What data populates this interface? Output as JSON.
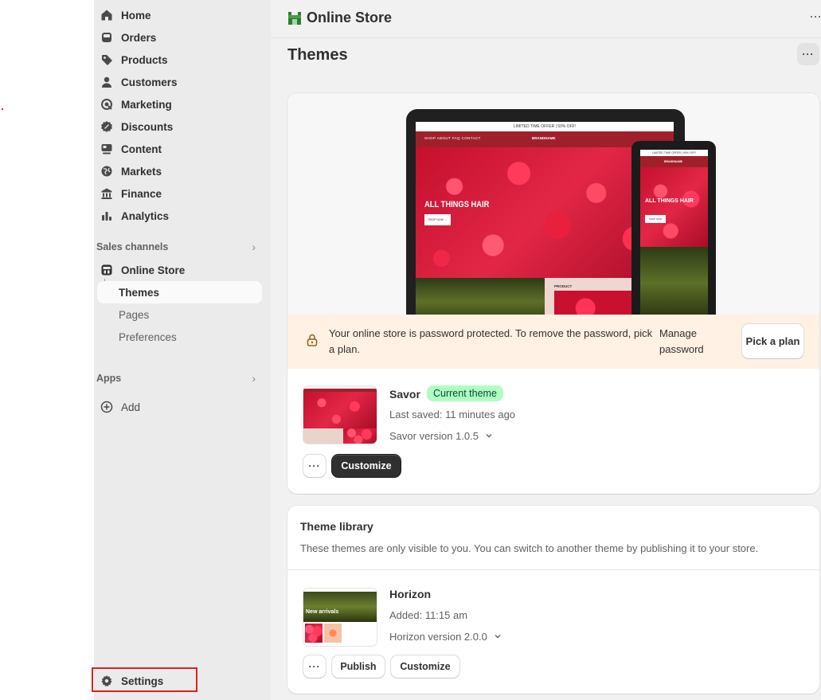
{
  "sidebar": {
    "items": [
      {
        "label": "Home",
        "icon": "home-icon"
      },
      {
        "label": "Orders",
        "icon": "inbox-icon"
      },
      {
        "label": "Products",
        "icon": "tag-icon"
      },
      {
        "label": "Customers",
        "icon": "person-icon"
      },
      {
        "label": "Marketing",
        "icon": "target-icon"
      },
      {
        "label": "Discounts",
        "icon": "discount-icon"
      },
      {
        "label": "Content",
        "icon": "content-icon"
      },
      {
        "label": "Markets",
        "icon": "globe-icon"
      },
      {
        "label": "Finance",
        "icon": "bank-icon"
      },
      {
        "label": "Analytics",
        "icon": "bar-chart-icon"
      }
    ],
    "sales_channels_label": "Sales channels",
    "online_store_label": "Online Store",
    "sub_items": [
      "Themes",
      "Pages",
      "Preferences"
    ],
    "apps_label": "Apps",
    "add_label": "Add",
    "settings_label": "Settings"
  },
  "topbar": {
    "title": "Online Store",
    "more": "···"
  },
  "page": {
    "title": "Themes",
    "more": "···"
  },
  "preview": {
    "promo": "LIMITED TIME OFFER | 50% OFF!",
    "nav_links": "SHOP   ABOUT   FAQ   CONTACT",
    "brand": "BRANDNAME",
    "headline": "ALL THINGS HAIR",
    "cta": "SHOP NOW →",
    "product": "PRODUCT",
    "phone_headline": "ALL THINGS HAIR",
    "phone_cta": "SHOP NOW"
  },
  "banner": {
    "message": "Your online store is password protected. To remove the password, pick a plan.",
    "manage_link": "Manage password",
    "pick_plan": "Pick a plan"
  },
  "current_theme": {
    "name": "Savor",
    "badge": "Current theme",
    "last_saved": "Last saved: 11 minutes ago",
    "version": "Savor version 1.0.5",
    "more": "···",
    "customize": "Customize"
  },
  "library": {
    "title": "Theme library",
    "description": "These themes are only visible to you. You can switch to another theme by publishing it to your store.",
    "themes": [
      {
        "name": "Horizon",
        "added": "Added: 11:15 am",
        "version": "Horizon version 2.0.0",
        "thumb_label": "New arrivals",
        "more": "···",
        "publish": "Publish",
        "customize": "Customize"
      }
    ]
  },
  "colors": {
    "accent_dark": "#303030",
    "badge_green": "#affebf",
    "banner_bg": "#fff1e3",
    "highlight_box": "#e02020"
  }
}
